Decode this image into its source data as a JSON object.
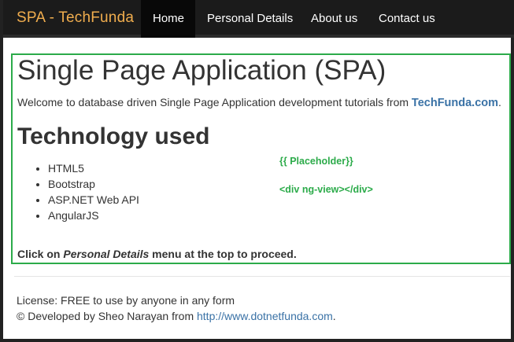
{
  "navbar": {
    "brand": "SPA - TechFunda",
    "items": [
      {
        "label": "Home",
        "active": true
      },
      {
        "label": "Personal Details",
        "active": false
      },
      {
        "label": "About us",
        "active": false
      },
      {
        "label": "Contact us",
        "active": false
      }
    ]
  },
  "main": {
    "title": "Single Page Application (SPA)",
    "welcome_prefix": "Welcome to database driven Single Page Application development tutorials from ",
    "welcome_link": "TechFunda.com",
    "welcome_suffix": ".",
    "subtitle": "Technology used",
    "technologies": [
      "HTML5",
      "Bootstrap",
      "ASP.NET Web API",
      "AngularJS"
    ],
    "placeholder_label": "{{ Placeholder}}",
    "placeholder_tag": "<div ng-view></div>",
    "instruction_prefix": "Click on ",
    "instruction_em": "Personal Details",
    "instruction_suffix": " menu at the top to proceed."
  },
  "footer": {
    "license": "License: FREE to use by anyone in any form",
    "developed_prefix": "© Developed by Sheo Narayan from ",
    "developed_link": "http://www.dotnetfunda.com",
    "developed_suffix": "."
  },
  "colors": {
    "navbar_bg": "#1b1b1b",
    "brand": "#f0ad4e",
    "placeholder_border": "#2cab4a",
    "link": "#3a72a6"
  }
}
